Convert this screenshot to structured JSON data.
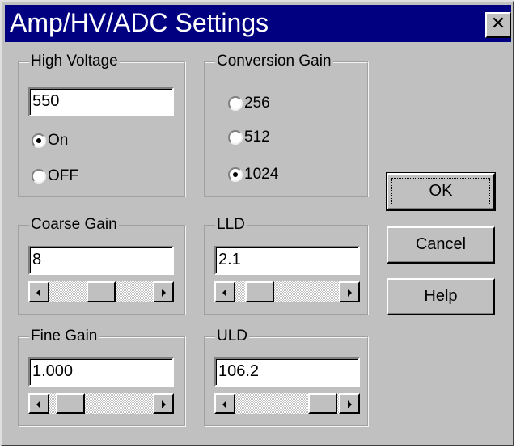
{
  "window": {
    "title": "Amp/HV/ADC Settings",
    "close_glyph": "✕"
  },
  "high_voltage": {
    "label": "High Voltage",
    "value": "550",
    "options": [
      {
        "label": "On",
        "checked": true
      },
      {
        "label": "OFF",
        "checked": false
      }
    ]
  },
  "conversion_gain": {
    "label": "Conversion Gain",
    "options": [
      {
        "label": "256",
        "checked": false
      },
      {
        "label": "512",
        "checked": false
      },
      {
        "label": "1024",
        "checked": true
      }
    ]
  },
  "coarse_gain": {
    "label": "Coarse Gain",
    "value": "8"
  },
  "lld": {
    "label": "LLD",
    "value": "2.1"
  },
  "fine_gain": {
    "label": "Fine Gain",
    "value": "1.000"
  },
  "uld": {
    "label": "ULD",
    "value": "106.2"
  },
  "buttons": {
    "ok": "OK",
    "cancel": "Cancel",
    "help": "Help"
  }
}
